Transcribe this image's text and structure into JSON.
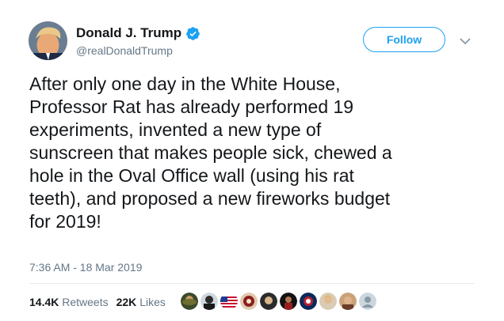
{
  "author": {
    "display_name": "Donald J. Trump",
    "handle": "@realDonaldTrump",
    "verified": true,
    "avatar_icon": "profile-photo"
  },
  "follow_button": {
    "label": "Follow"
  },
  "tweet": {
    "lines": [
      "After only one day in the White House,",
      "Professor Rat has already performed 19",
      "experiments, invented a new type of",
      "sunscreen that makes people sick, chewed a",
      "hole in the Oval Office wall (using his rat",
      "teeth), and proposed a new fireworks budget",
      "for 2019!"
    ],
    "timestamp": "7:36 AM - 18 Mar 2019"
  },
  "stats": {
    "retweets_count": "14.4K",
    "retweets_label": "Retweets",
    "likes_count": "22K",
    "likes_label": "Likes"
  },
  "colors": {
    "accent": "#1da1f2",
    "secondary_text": "#657786",
    "primary_text": "#14171a",
    "divider": "#e6ecf0"
  },
  "liker_avatars": [
    "avatar-1",
    "avatar-2",
    "avatar-flag",
    "avatar-4",
    "avatar-5",
    "avatar-6",
    "avatar-7",
    "avatar-8",
    "avatar-9",
    "avatar-default"
  ]
}
